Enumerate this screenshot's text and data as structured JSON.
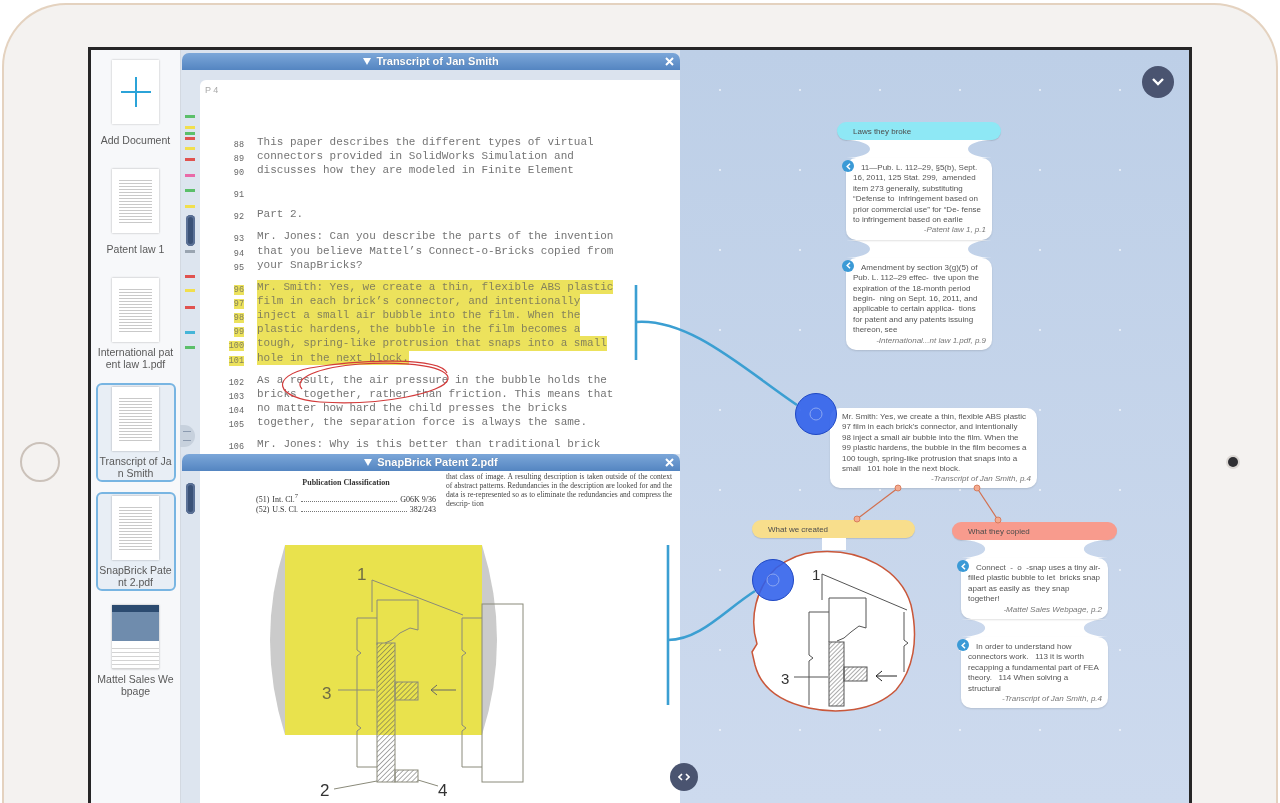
{
  "sidebar": {
    "items": [
      {
        "kind": "add",
        "label": "Add Document",
        "selected": false
      },
      {
        "kind": "document",
        "label": "Patent law 1",
        "selected": false
      },
      {
        "kind": "document",
        "label": "International patent law 1.pdf",
        "selected": false
      },
      {
        "kind": "document",
        "label": "Transcript of Jan Smith",
        "selected": true
      },
      {
        "kind": "document",
        "label": "SnapBrick Patent 2.pdf",
        "selected": true
      },
      {
        "kind": "webpage",
        "label": "Mattel Sales Webpage",
        "selected": false
      }
    ]
  },
  "transcript_panel": {
    "title": "Transcript of Jan Smith",
    "page_label": "P 4",
    "margin_marks": [
      {
        "color": "#5cbf6a"
      },
      {
        "color": "#f1df4e"
      },
      {
        "color": "#5cbf6a"
      },
      {
        "color": "#e0524f"
      },
      {
        "color": "#f1df4e"
      },
      {
        "color": "#e0524f"
      },
      {
        "color": "#e96aa8"
      },
      {
        "color": "#5cbf6a"
      },
      {
        "color": "#f1df4e"
      },
      {
        "color": "#9aa5b1"
      },
      {
        "color": "#e0524f"
      },
      {
        "color": "#f1df4e"
      },
      {
        "color": "#e0524f"
      },
      {
        "color": "#45b5d8"
      },
      {
        "color": "#5cbf6a"
      }
    ],
    "paragraphs": [
      {
        "highlighted": false,
        "lines": [
          {
            "number": "88",
            "text": "This paper describes the different types of virtual"
          },
          {
            "number": "89",
            "text": "connectors provided in SolidWorks Simulation and"
          },
          {
            "number": "90",
            "text": "discusses how they are modeled in Finite Element"
          }
        ]
      },
      {
        "highlighted": false,
        "lines": [
          {
            "number": "91"
          }
        ]
      },
      {
        "highlighted": false,
        "lines": [
          {
            "number": "92",
            "text": "Part 2."
          }
        ]
      },
      {
        "highlighted": false,
        "lines": [
          {
            "number": "93",
            "text": "Mr. Jones: Can you describe the parts of the invention"
          },
          {
            "number": "94",
            "text": "that you believe Mattel’s Connect-o-Bricks copied from"
          },
          {
            "number": "95",
            "text": "your SnapBricks?"
          }
        ]
      },
      {
        "highlighted": true,
        "lines": [
          {
            "number": "96",
            "text": "Mr. Smith: Yes, we create a thin, flexible ABS plastic"
          },
          {
            "number": "97",
            "text": "film in each brick’s connector, and intentionally"
          },
          {
            "number": "98",
            "text": "inject a small air bubble into the film. When the"
          },
          {
            "number": "99",
            "text": "plastic hardens, the bubble in the film becomes a"
          },
          {
            "number": "100",
            "text": "tough, spring-like protrusion that snaps into a small"
          },
          {
            "number": "101",
            "text": "hole in the next block."
          }
        ]
      },
      {
        "highlighted": false,
        "lines": [
          {
            "number": "102",
            "text": "As a result, the air pressure in the bubble holds the"
          },
          {
            "number": "103",
            "text": "bricks together, rather than friction. This means that"
          },
          {
            "number": "104",
            "text": "no matter how hard the child presses the bricks"
          },
          {
            "number": "105",
            "text": "together, the separation force is always the same."
          }
        ]
      },
      {
        "highlighted": false,
        "lines": [
          {
            "number": "106",
            "text": "Mr. Jones: Why is this better than traditional brick"
          }
        ]
      }
    ]
  },
  "patent_panel": {
    "title": "SnapBrick Patent 2.pdf",
    "classification": {
      "heading": "Publication Classification",
      "rows": [
        {
          "code": "(51)",
          "label": "Int. Cl.$^{7}$",
          "value": "G06K 9/36"
        },
        {
          "code": "(52)",
          "label": "U.S. Cl.",
          "value": "382/243"
        }
      ]
    },
    "abstract_text": "that class of image. A resulting description is taken outside of the context of abstract patterns. Redundancies in the description are looked for and the data is re-represented so as to eliminate the redundancies and compress the descrip- tion",
    "figure": {
      "labels": [
        "1",
        "3",
        "2",
        "4"
      ]
    }
  },
  "canvas": {
    "nodes": [
      {
        "kind": "group",
        "title": "Laws they broke",
        "color": "#8ee8f5",
        "items": [
          {
            "kind": "quote",
            "text": "11—Pub. L. 112–29, §5(b), Sept. 16, 2011, 125 Stat. 299,  amended item 273 generally, substituting “Defense to  infringement based on prior commercial use” for “De- fense to infringement based on earlie",
            "source": "-Patent law 1, p.1"
          },
          {
            "kind": "quote",
            "text": "Amendment by section 3(g)(5) of Pub. L. 112–29 effec-  tive upon the expiration of the 18-month period begin-  ning on Sept. 16, 2011, and applicable to certain applica-  tions for patent and any patents issuing thereon, see",
            "source": "-International...nt law 1.pdf, p.9"
          }
        ]
      },
      {
        "kind": "excerpt",
        "text": "Mr. Smith: Yes, we create a thin, flexible ABS plastic   97 film in each brick's connector, and intentionally   98 inject a small air bubble into the film. When the   99 plastic hardens, the bubble in the film becomes a   100 tough, spring-like protrusion that snaps into a small   101 hole in the next block.",
        "source": "-Transcript of Jan Smith, p.4"
      },
      {
        "kind": "group",
        "title": "What we created",
        "color": "#f8de8c",
        "items": [
          {
            "kind": "clip",
            "labels": [
              "1",
              "3"
            ]
          }
        ]
      },
      {
        "kind": "group",
        "title": "What they copied",
        "color": "#f89b8d",
        "items": [
          {
            "kind": "quote",
            "text": "Connect  -  o  -snap uses a tiny air-filled plastic bubble to let  bricks snap apart as easily as  they snap together!",
            "source": "-Mattel Sales Webpage, p.2"
          },
          {
            "kind": "quote",
            "text": "In order to understand how connectors work.   113 it is worth recapping a fundamental part of FEA theory.   114 When solving a structural",
            "source": "-Transcript of Jan Smith, p.4"
          }
        ]
      }
    ]
  }
}
